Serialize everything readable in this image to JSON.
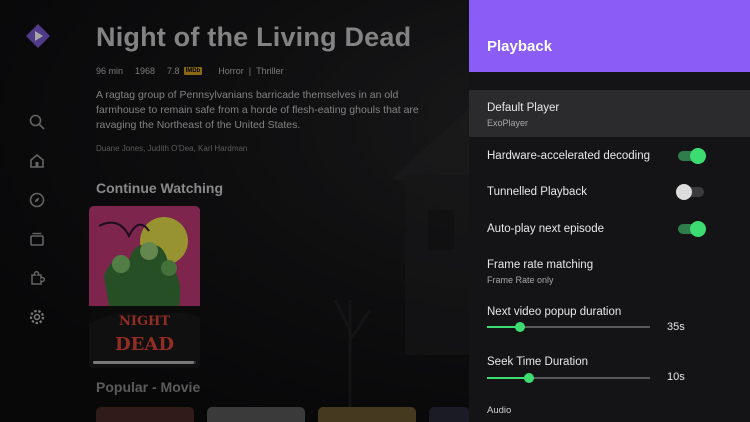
{
  "hero": {
    "title": "Night of the Living Dead",
    "runtime": "96 min",
    "year": "1968",
    "rating": "7.8",
    "rating_badge": "IMDb",
    "genres": [
      "Horror",
      "Thriller"
    ],
    "genre_separator": "|",
    "description": "A ragtag group of Pennsylvanians barricade themselves in an old farmhouse to remain safe from a horde of flesh-eating ghouls that are ravaging the Northeast of the United States.",
    "cast": "Duane Jones, Judith O'Dea, Karl Hardman"
  },
  "nav": {
    "items": [
      {
        "name": "search-icon"
      },
      {
        "name": "home-icon"
      },
      {
        "name": "discover-icon"
      },
      {
        "name": "library-icon"
      },
      {
        "name": "addons-icon"
      },
      {
        "name": "settings-icon"
      }
    ]
  },
  "sections": {
    "continue_watching": "Continue Watching",
    "popular": "Popular - Movie"
  },
  "poster": {
    "title_line1": "NIGHT",
    "title_line2": "DEAD",
    "progress": 0.98
  },
  "panel": {
    "title": "Playback",
    "accent_color": "#8b5cf6",
    "toggle_on_color": "#3ddc73",
    "rows": {
      "default_player": {
        "label": "Default Player",
        "value": "ExoPlayer"
      },
      "hw_decoding": {
        "label": "Hardware-accelerated decoding",
        "on": true
      },
      "tunnelled": {
        "label": "Tunnelled Playback",
        "on": false
      },
      "autoplay": {
        "label": "Auto-play next episode",
        "on": true
      },
      "frame_rate": {
        "label": "Frame rate matching",
        "value": "Frame Rate only"
      },
      "next_popup": {
        "label": "Next video popup duration",
        "value": "35s",
        "level": 0.2
      },
      "seek_time": {
        "label": "Seek Time Duration",
        "value": "10s",
        "level": 0.26
      },
      "audio": {
        "label": "Audio"
      }
    }
  }
}
